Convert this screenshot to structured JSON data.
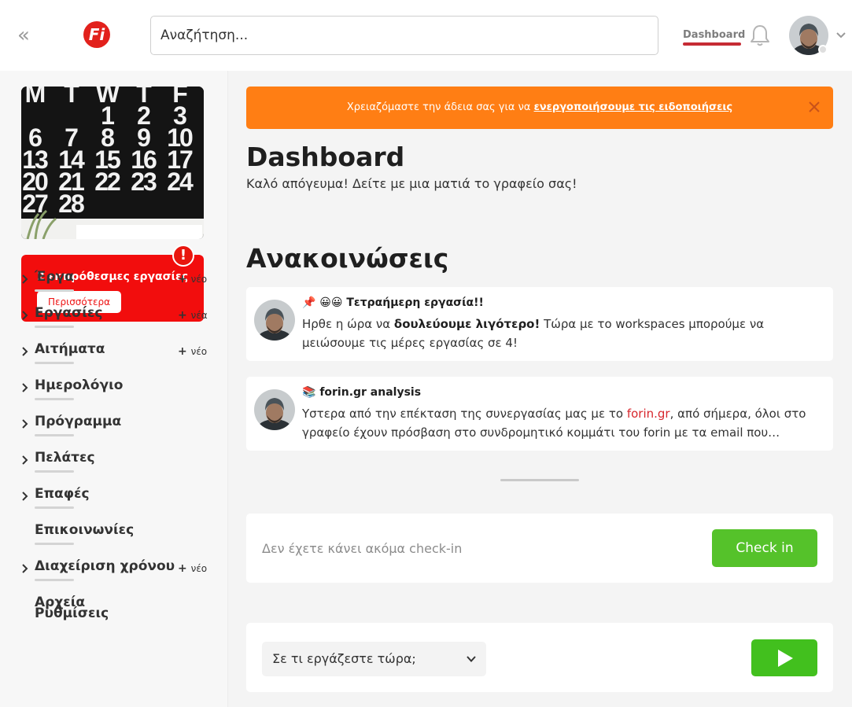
{
  "header": {
    "logo_text": "Fi",
    "search_placeholder": "Αναζήτηση...",
    "dashboard_link": "Dashboard"
  },
  "sidebar": {
    "calendar_image": {
      "rows": [
        [
          "M",
          "T",
          "W",
          "T",
          "F"
        ],
        [
          "",
          "",
          "1",
          "2",
          "3"
        ],
        [
          "6",
          "7",
          "8",
          "9",
          "10"
        ],
        [
          "13",
          "14",
          "15",
          "16",
          "17"
        ],
        [
          "20",
          "21",
          "22",
          "23",
          "24"
        ],
        [
          "27",
          "28",
          "",
          "",
          ""
        ]
      ]
    },
    "alert": {
      "text": "2 εκπρόθεσμες εργασίες",
      "button": "Περισσότερα",
      "badge": "!"
    },
    "items": [
      {
        "label": "Έργα",
        "new": "νέο"
      },
      {
        "label": "Εργασίες",
        "new": "νέα"
      },
      {
        "label": "Αιτήματα",
        "new": "νέο"
      },
      {
        "label": "Ημερολόγιο",
        "new": ""
      },
      {
        "label": "Πρόγραμμα",
        "new": ""
      },
      {
        "label": "Πελάτες",
        "new": ""
      },
      {
        "label": "Επαφές",
        "new": ""
      },
      {
        "label": "Επικοινωνίες",
        "new": ""
      },
      {
        "label": "Διαχείριση χρόνου",
        "new": "νέο"
      },
      {
        "label": "Αρχεία",
        "new": ""
      },
      {
        "label": "Ρυθμίσεις",
        "new": ""
      }
    ]
  },
  "banner": {
    "text": "Χρειαζόμαστε την άδεια σας για να ",
    "link": "ενεργοποιήσουμε τις ειδοποιήσεις"
  },
  "main": {
    "title": "Dashboard",
    "subtitle": "Καλό απόγευμα! Δείτε με μια ματιά το γραφείο σας!",
    "announcements_title": "Ανακοινώσεις",
    "posts": [
      {
        "title_prefix": "📌 😀😀 ",
        "title": "Τετραήμερη εργασία!!",
        "body_start": "Ηρθε η ώρα να ",
        "body_bold": "δουλεύουμε λιγότερο!",
        "body_end": " Τώρα με το workspaces μπορούμε να μειώσουμε τις μέρες εργασίας σε 4!"
      },
      {
        "title_prefix": "📚 ",
        "title": "forin.gr analysis",
        "body_start": "Υστερα από την επέκταση της συνεργασίας μας με το ",
        "body_link": "forin.gr",
        "body_end": ", από σήμερα, όλοι στο γραφείο έχουν πρόσβαση στο συνδρομητικό κομμάτι του forin με τα email που…"
      }
    ],
    "checkin": {
      "text": "Δεν έχετε κάνει ακόμα check-in",
      "button": "Check in"
    },
    "work": {
      "placeholder": "Σε τι εργάζεστε τώρα;"
    }
  },
  "colors": {
    "brand_red": "#e2211c",
    "alert_red": "#f20d0d",
    "banner_orange": "#ff7e14",
    "checkin_green": "#55c22a",
    "play_green": "#42c01e",
    "link_red": "#d7262c",
    "tab_underline": "#c62b34"
  },
  "icons": {
    "collapse": "double-chevron-left-icon",
    "bell": "bell-icon",
    "close": "close-icon",
    "play": "play-icon"
  }
}
